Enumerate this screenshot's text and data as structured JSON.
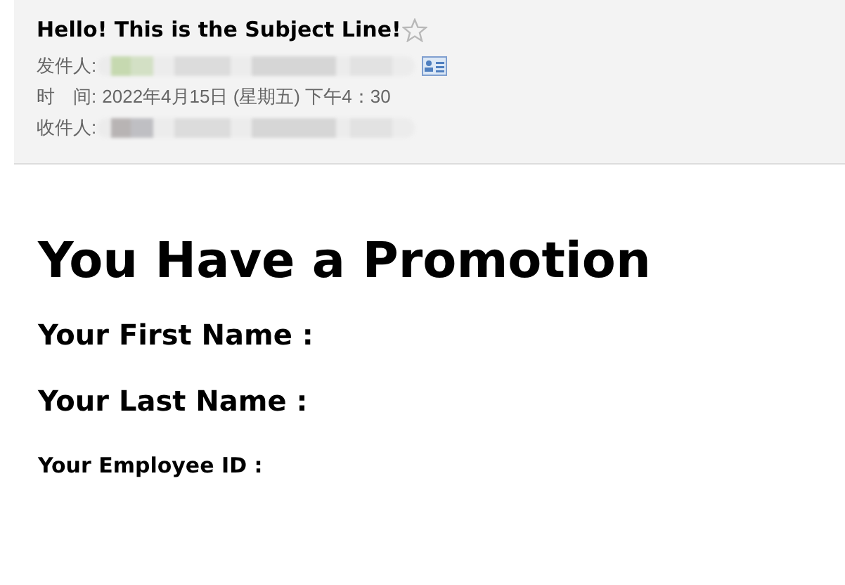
{
  "header": {
    "subject": "Hello! This is the Subject Line!",
    "starred": false,
    "fields": [
      {
        "kind": "redacted_with_card",
        "label": "发件人:"
      },
      {
        "kind": "text",
        "label": "时　间:",
        "value": "2022年4月15日 (星期五) 下午4：30"
      },
      {
        "kind": "redacted",
        "label": "收件人:"
      }
    ]
  },
  "body": {
    "heading": "You Have a Promotion",
    "fields": [
      {
        "kind": "large",
        "label": "Your First Name :"
      },
      {
        "kind": "large",
        "label": "Your Last Name :"
      },
      {
        "kind": "small",
        "label": "Your Employee ID :"
      }
    ]
  }
}
